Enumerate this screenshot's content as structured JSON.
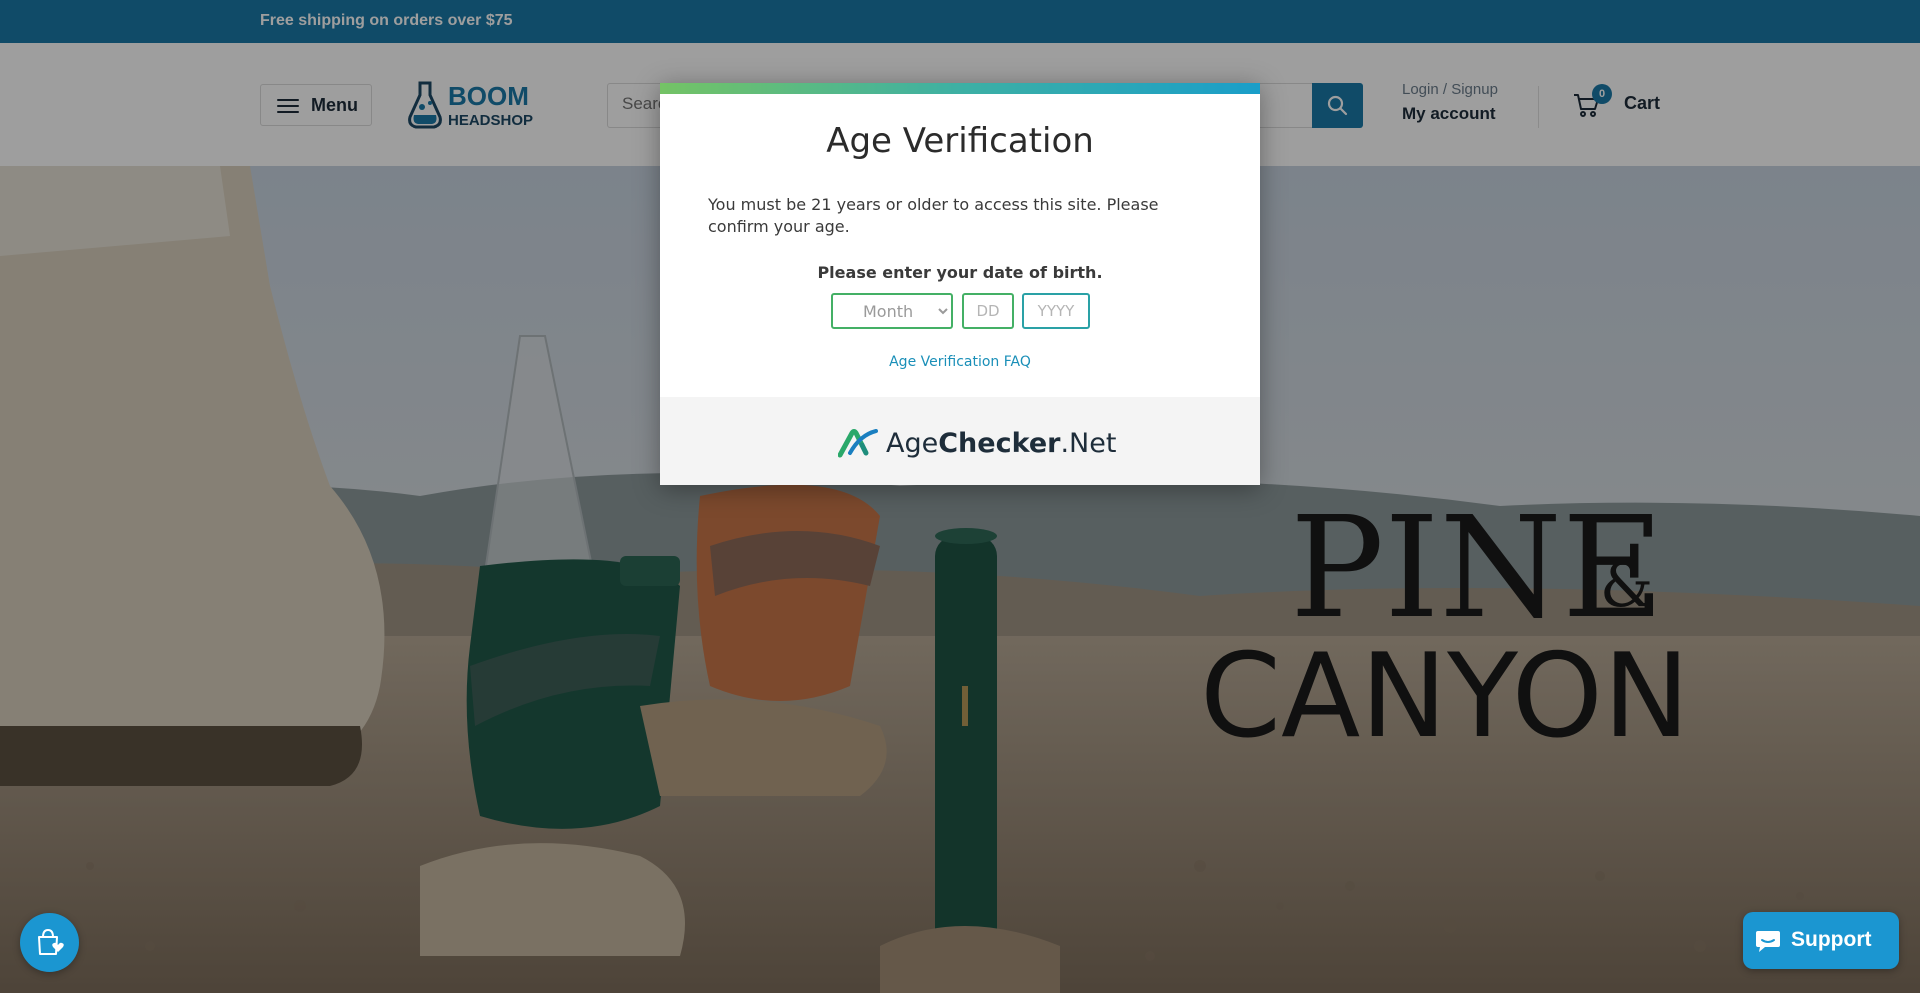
{
  "announcement": {
    "text": "Free shipping on orders over $75"
  },
  "header": {
    "menu_label": "Menu",
    "logo": {
      "line1": "BOOM",
      "line2": "HEADSHOP"
    },
    "search": {
      "placeholder": "Search..."
    },
    "account": {
      "small": "Login / Signup",
      "big": "My account"
    },
    "cart": {
      "count": "0",
      "label": "Cart"
    }
  },
  "hero": {
    "brand_line1": "PINE",
    "brand_amp": "&",
    "brand_line2": "CANYON"
  },
  "modal": {
    "title": "Age Verification",
    "message": "You must be 21 years or older to access this site. Please confirm your age.",
    "dob_label": "Please enter your date of birth.",
    "month_selected": "Month",
    "day_placeholder": "DD",
    "year_placeholder": "YYYY",
    "faq_link": "Age Verification FAQ",
    "brand": {
      "part1": "Age",
      "part2": "Checker",
      "part3": ".Net"
    }
  },
  "floating": {
    "support_label": "Support"
  },
  "colors": {
    "primary": "#1b7aa8",
    "accent_green": "#44b065",
    "chat_blue": "#1b96d1"
  }
}
